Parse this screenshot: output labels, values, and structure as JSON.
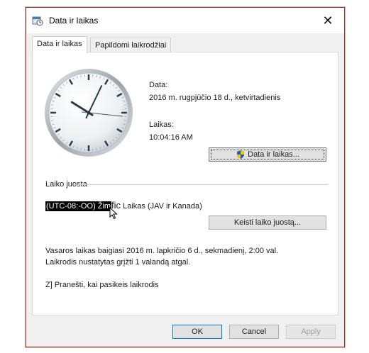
{
  "window": {
    "title": "Data ir laikas",
    "close_glyph": "✕",
    "title_icon": "date-time-icon"
  },
  "tabs": [
    {
      "label": "Data ir laikas",
      "active": true
    },
    {
      "label": "Papildomi laikrodžiai",
      "active": false
    }
  ],
  "clock": {
    "hour": 10,
    "minute": 4,
    "second": 16
  },
  "date": {
    "label": "Data:",
    "value": "2016 m. rugpjūčio 18 d., ketvirtadienis"
  },
  "time": {
    "label": "Laikas:",
    "value": "10:04:16 AM"
  },
  "change_date_button": {
    "label": "Data ir laikas...",
    "icon": "uac-shield-icon"
  },
  "timezone": {
    "group_label": "Laiko juosta",
    "selected_part": "(UTC-08:-OO) Žim",
    "selected_tail": "fic",
    "rest": " Laikas (JAV ir Kanada)",
    "change_button": "Keisti laiko juostą..."
  },
  "dst": {
    "line1": "Vasaros laikas baigiasi 2016 m. lapkričio 6 d., sekmadienį, 2:00 val.",
    "line2": "Laikrodis nustatytas grįžti 1 valandą atgal."
  },
  "notify": {
    "text": "Z] Pranešti, kai pasikeis laikrodis"
  },
  "footer": {
    "ok": "OK",
    "cancel": "Cancel",
    "apply": "Apply"
  },
  "colors": {
    "frame": "#8a3b2e",
    "primary_border": "#0078d7",
    "panel": "#ffffff"
  }
}
